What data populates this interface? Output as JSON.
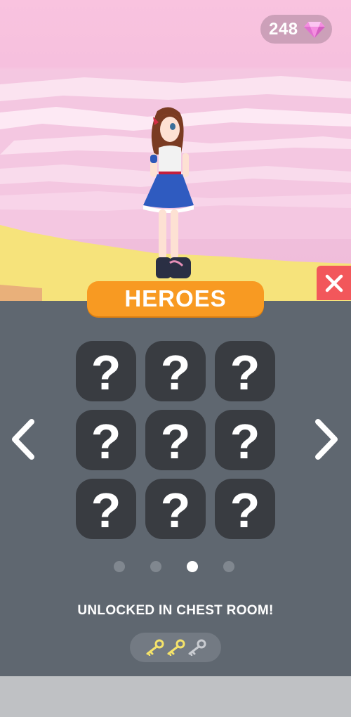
{
  "currency": {
    "gems": "248",
    "icon": "diamond-icon",
    "gem_color": "#f48fe0"
  },
  "panel": {
    "title": "HEROES",
    "slot_label": "?",
    "slot_count": 9,
    "pages": 4,
    "current_page": 3,
    "hint": "UNLOCKED IN CHEST ROOM!"
  },
  "keys": [
    {
      "state": "collected",
      "color": "#f5e36a"
    },
    {
      "state": "collected",
      "color": "#f5e36a"
    },
    {
      "state": "empty",
      "color": "#c9ccd1"
    }
  ],
  "colors": {
    "banner": "#f89a22",
    "close": "#f2575b",
    "panel": "#5f6770",
    "slot": "#393c41"
  }
}
